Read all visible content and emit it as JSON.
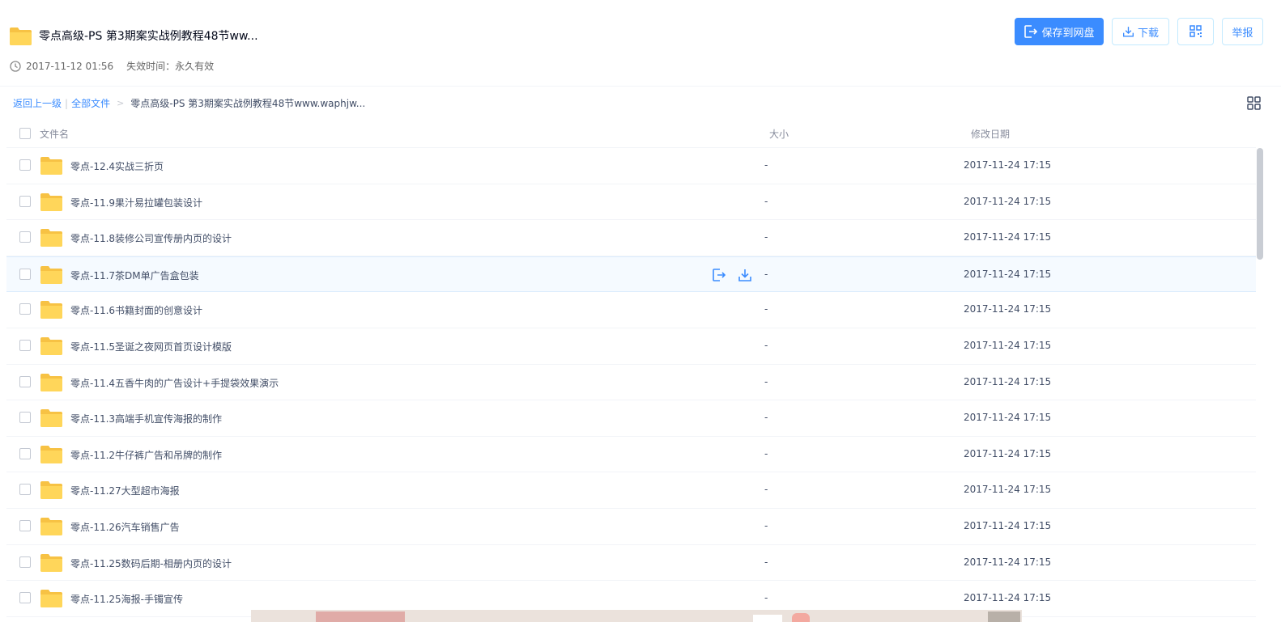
{
  "share": {
    "title": "零点高级-PS 第3期案实战例教程48节ww...",
    "date": "2017-11-12 01:56",
    "expire": "失效时间：永久有效"
  },
  "actions": {
    "save": "保存到网盘",
    "download": "下载",
    "report": "举报"
  },
  "breadcrumb": {
    "back": "返回上一级",
    "separator": "|",
    "all_files": "全部文件",
    "arrow": ">",
    "current": "零点高级-PS 第3期案实战例教程48节www.waphjw..."
  },
  "columns": {
    "name": "文件名",
    "size": "大小",
    "date": "修改日期"
  },
  "files": [
    {
      "name": "零点-12.4实战三折页",
      "size": "-",
      "date": "2017-11-24 17:15"
    },
    {
      "name": "零点-11.9果汁易拉罐包装设计",
      "size": "-",
      "date": "2017-11-24 17:15"
    },
    {
      "name": "零点-11.8装修公司宣传册内页的设计",
      "size": "-",
      "date": "2017-11-24 17:15"
    },
    {
      "name": "零点-11.7茶DM单广告盒包装",
      "size": "-",
      "date": "2017-11-24 17:15"
    },
    {
      "name": "零点-11.6书籍封面的创意设计",
      "size": "-",
      "date": "2017-11-24 17:15"
    },
    {
      "name": "零点-11.5圣诞之夜网页首页设计模版",
      "size": "-",
      "date": "2017-11-24 17:15"
    },
    {
      "name": "零点-11.4五香牛肉的广告设计+手提袋效果演示",
      "size": "-",
      "date": "2017-11-24 17:15"
    },
    {
      "name": "零点-11.3高端手机宣传海报的制作",
      "size": "-",
      "date": "2017-11-24 17:15"
    },
    {
      "name": "零点-11.2牛仔裤广告和吊牌的制作",
      "size": "-",
      "date": "2017-11-24 17:15"
    },
    {
      "name": "零点-11.27大型超市海报",
      "size": "-",
      "date": "2017-11-24 17:15"
    },
    {
      "name": "零点-11.26汽车销售广告",
      "size": "-",
      "date": "2017-11-24 17:15"
    },
    {
      "name": "零点-11.25数码后期-相册内页的设计",
      "size": "-",
      "date": "2017-11-24 17:15"
    },
    {
      "name": "零点-11.25海报-手镯宣传",
      "size": "-",
      "date": "2017-11-24 17:15"
    }
  ],
  "hovered_row_index": 3,
  "icons": {
    "folder": "folder-icon",
    "clock": "clock-icon",
    "save": "save-to-cloud-icon",
    "download": "download-icon",
    "qr": "qr-code-icon",
    "grid": "grid-view-icon"
  },
  "colors": {
    "accent": "#3b8cff",
    "folder": "#ffd65a",
    "folder_tab": "#f7c244",
    "text": "#424e67",
    "muted": "#878c9c"
  }
}
